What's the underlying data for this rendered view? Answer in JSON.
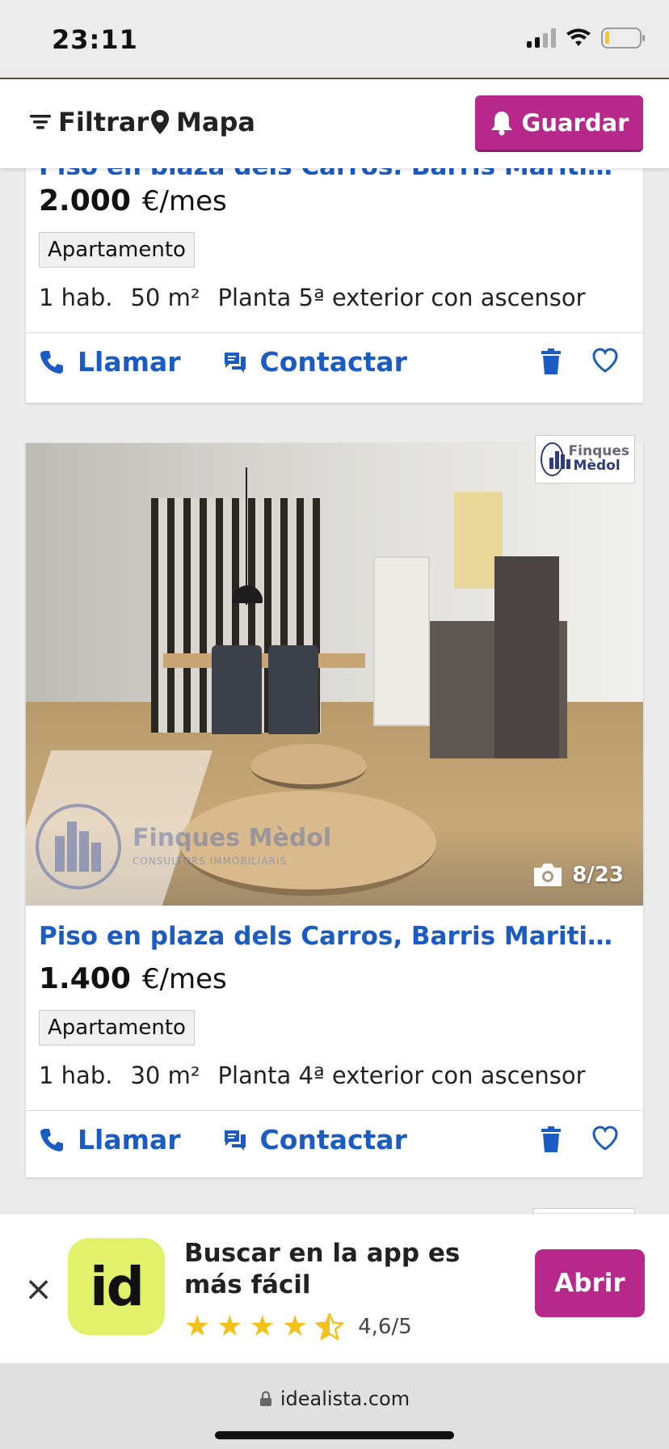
{
  "status_bar": {
    "time": "23:11"
  },
  "toolbar": {
    "filter_label": "Filtrar",
    "map_label": "Mapa",
    "save_label": "Guardar"
  },
  "listings": [
    {
      "title": "Piso en plaza dels Carros, Barris Maritims, T...",
      "price": "2.000",
      "price_unit": "€/mes",
      "type": "Apartamento",
      "rooms": "1 hab.",
      "area": "50 m²",
      "floor": "Planta 5ª exterior con ascensor",
      "call_label": "Llamar",
      "contact_label": "Contactar"
    },
    {
      "title": "Piso en plaza dels Carros, Barris Maritims, T...",
      "price": "1.400",
      "price_unit": "€/mes",
      "type": "Apartamento",
      "rooms": "1 hab.",
      "area": "30 m²",
      "floor": "Planta 4ª exterior con ascensor",
      "call_label": "Llamar",
      "contact_label": "Contactar",
      "photo_count": "8/23",
      "agency_logo_text": [
        "Finques",
        "Mèdol"
      ],
      "watermark_text": [
        "Finques Mèdol",
        "CONSULTORS IMMOBILIARIS"
      ]
    }
  ],
  "app_banner": {
    "close_icon": "×",
    "app_icon_text": "id",
    "text": "Buscar en la app es más fácil",
    "rating": "4,6/5",
    "stars": 4.5,
    "open_label": "Abrir"
  },
  "browser": {
    "url": "idealista.com"
  },
  "colors": {
    "brand": "#b6298b",
    "link": "#1a5bc4",
    "app_icon": "#e1f26a"
  }
}
